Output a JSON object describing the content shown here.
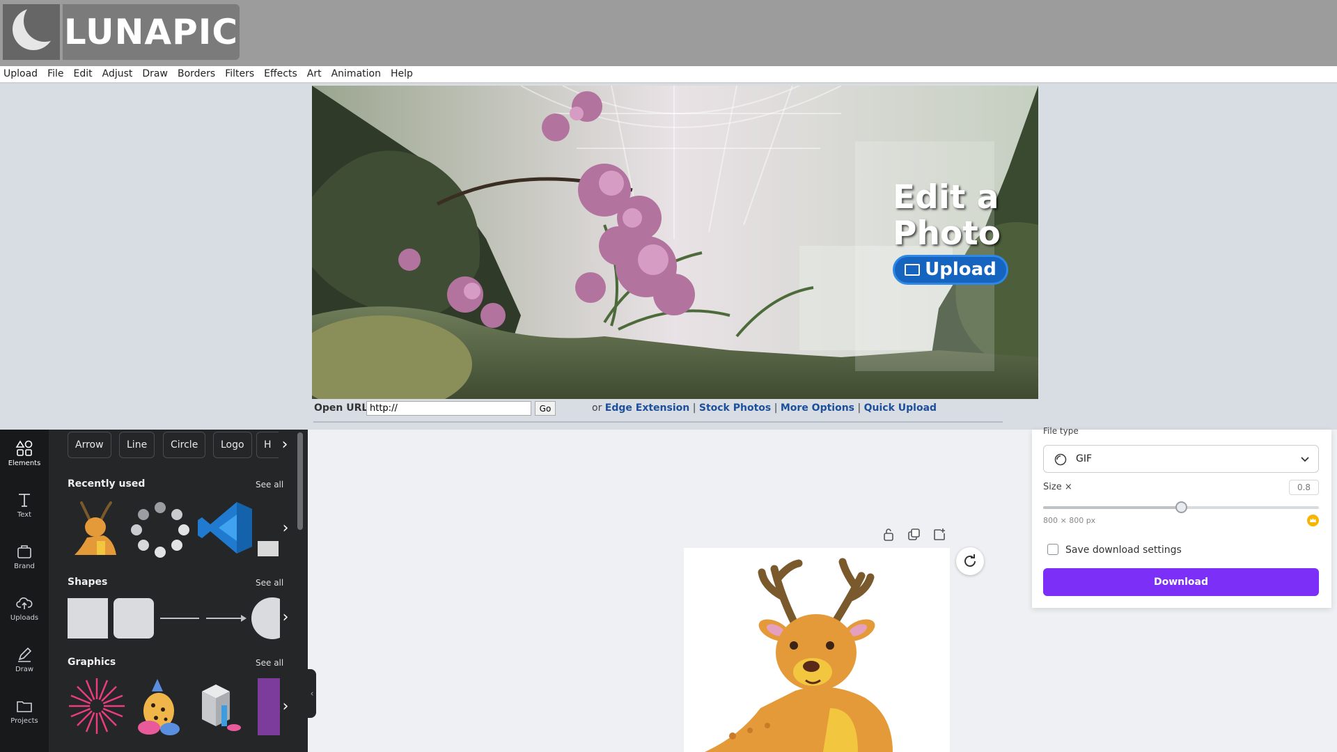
{
  "lunapic": {
    "logo_text": "LUNAPIC",
    "menu": [
      "Upload",
      "File",
      "Edit",
      "Adjust",
      "Draw",
      "Borders",
      "Filters",
      "Effects",
      "Art",
      "Animation",
      "Help"
    ],
    "banner": {
      "headline_line1": "Edit a",
      "headline_line2": "Photo",
      "upload_label": "Upload"
    },
    "url_bar": {
      "label": "Open URL:",
      "value": "http://",
      "go_label": "Go",
      "prefix": "or",
      "links": [
        "Edge Extension",
        "Stock Photos",
        "More Options",
        "Quick Upload"
      ],
      "separator": "|"
    }
  },
  "editor": {
    "rail": [
      "Elements",
      "Text",
      "Brand",
      "Uploads",
      "Draw",
      "Projects"
    ],
    "chips": [
      "Arrow",
      "Line",
      "Circle",
      "Logo",
      "H"
    ],
    "sections": {
      "recently_used": "Recently used",
      "shapes": "Shapes",
      "graphics": "Graphics",
      "see_all": "See all"
    },
    "download_panel": {
      "file_type_label": "File type",
      "file_type_value": "GIF",
      "size_label": "Size ×",
      "size_value": "0.8",
      "size_fraction": 0.5,
      "dimensions": "800 × 800 px",
      "save_settings_label": "Save download settings",
      "download_label": "Download"
    },
    "colors": {
      "accent": "#7b2ff7",
      "panel_bg": "#252627",
      "rail_bg": "#18191b"
    }
  }
}
